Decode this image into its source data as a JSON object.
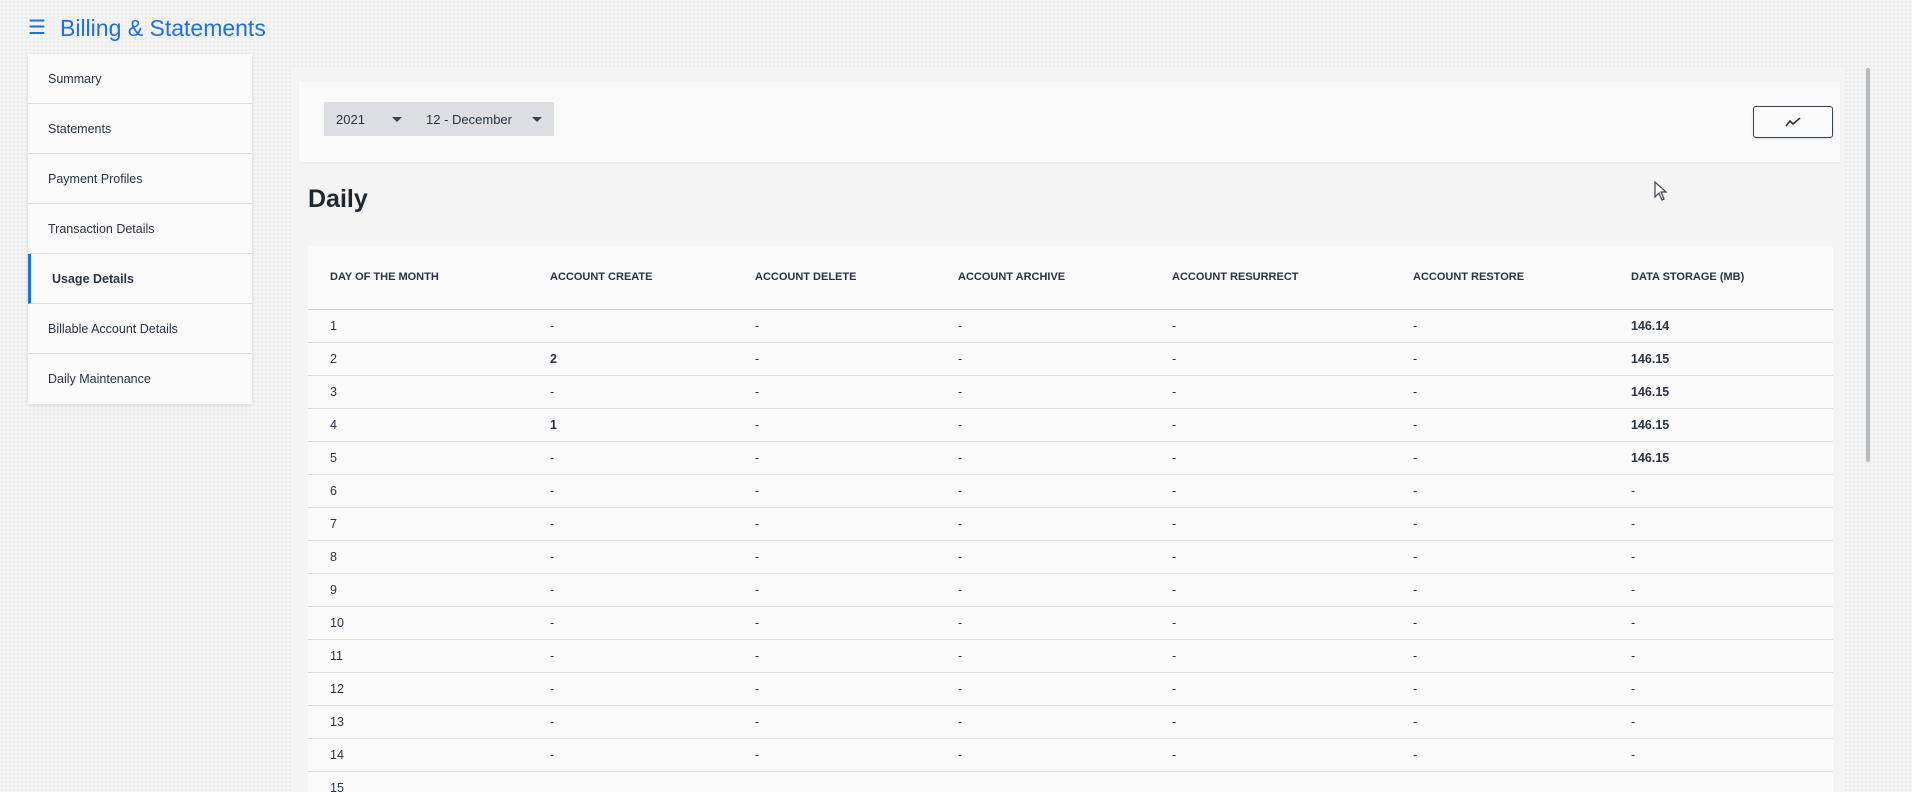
{
  "app": {
    "title": "Billing & Statements",
    "menu_icon": "hamburger-menu-icon"
  },
  "sidebar": {
    "items": [
      {
        "label": "Summary",
        "active": false
      },
      {
        "label": "Statements",
        "active": false
      },
      {
        "label": "Payment Profiles",
        "active": false
      },
      {
        "label": "Transaction Details",
        "active": false
      },
      {
        "label": "Usage Details",
        "active": true
      },
      {
        "label": "Billable Account Details",
        "active": false
      },
      {
        "label": "Daily Maintenance",
        "active": false
      }
    ]
  },
  "filters": {
    "year": "2021",
    "month": "12 - December",
    "chart_button_icon": "trend-line-chart-icon"
  },
  "section": {
    "title": "Daily"
  },
  "table": {
    "columns": [
      "DAY OF THE MONTH",
      "ACCOUNT CREATE",
      "ACCOUNT DELETE",
      "ACCOUNT ARCHIVE",
      "ACCOUNT RESURRECT",
      "ACCOUNT RESTORE",
      "DATA STORAGE (MB)"
    ],
    "rows": [
      [
        "1",
        "-",
        "-",
        "-",
        "-",
        "-",
        "146.14"
      ],
      [
        "2",
        "2",
        "-",
        "-",
        "-",
        "-",
        "146.15"
      ],
      [
        "3",
        "-",
        "-",
        "-",
        "-",
        "-",
        "146.15"
      ],
      [
        "4",
        "1",
        "-",
        "-",
        "-",
        "-",
        "146.15"
      ],
      [
        "5",
        "-",
        "-",
        "-",
        "-",
        "-",
        "146.15"
      ],
      [
        "6",
        "-",
        "-",
        "-",
        "-",
        "-",
        "-"
      ],
      [
        "7",
        "-",
        "-",
        "-",
        "-",
        "-",
        "-"
      ],
      [
        "8",
        "-",
        "-",
        "-",
        "-",
        "-",
        "-"
      ],
      [
        "9",
        "-",
        "-",
        "-",
        "-",
        "-",
        "-"
      ],
      [
        "10",
        "-",
        "-",
        "-",
        "-",
        "-",
        "-"
      ],
      [
        "11",
        "-",
        "-",
        "-",
        "-",
        "-",
        "-"
      ],
      [
        "12",
        "-",
        "-",
        "-",
        "-",
        "-",
        "-"
      ],
      [
        "13",
        "-",
        "-",
        "-",
        "-",
        "-",
        "-"
      ],
      [
        "14",
        "-",
        "-",
        "-",
        "-",
        "-",
        "-"
      ],
      [
        "15",
        "",
        "",
        "",
        "",
        "",
        ""
      ]
    ]
  },
  "colors": {
    "accent": "#1f6fe0",
    "text": "#1f2733",
    "select_bg": "#dcdee1"
  }
}
